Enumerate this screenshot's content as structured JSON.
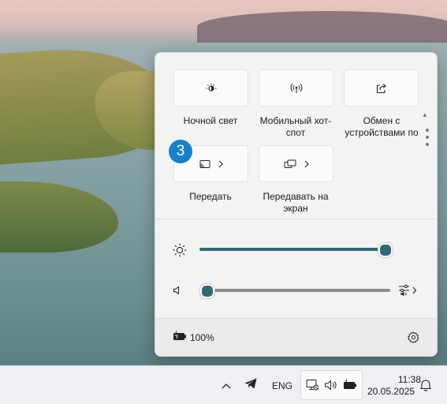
{
  "quick_settings": {
    "tiles": [
      {
        "label": "Ночной свет",
        "icon": "night-light-icon"
      },
      {
        "label": "Мобильный хот-спот",
        "icon": "hotspot-icon"
      },
      {
        "label": "Обмен с устройствами по",
        "icon": "share-icon"
      },
      {
        "label": "Передать",
        "icon": "cast-icon"
      },
      {
        "label": "Передавать на экран",
        "icon": "project-icon"
      }
    ],
    "brightness_level": 1.0,
    "volume_level": 0.0,
    "battery_percent": "100%"
  },
  "step_badge": "3",
  "taskbar": {
    "language": "ENG",
    "time": "11:38",
    "date": "20.05.2025"
  },
  "colors": {
    "accent": "#2d6b74",
    "badge": "#1680cf"
  }
}
